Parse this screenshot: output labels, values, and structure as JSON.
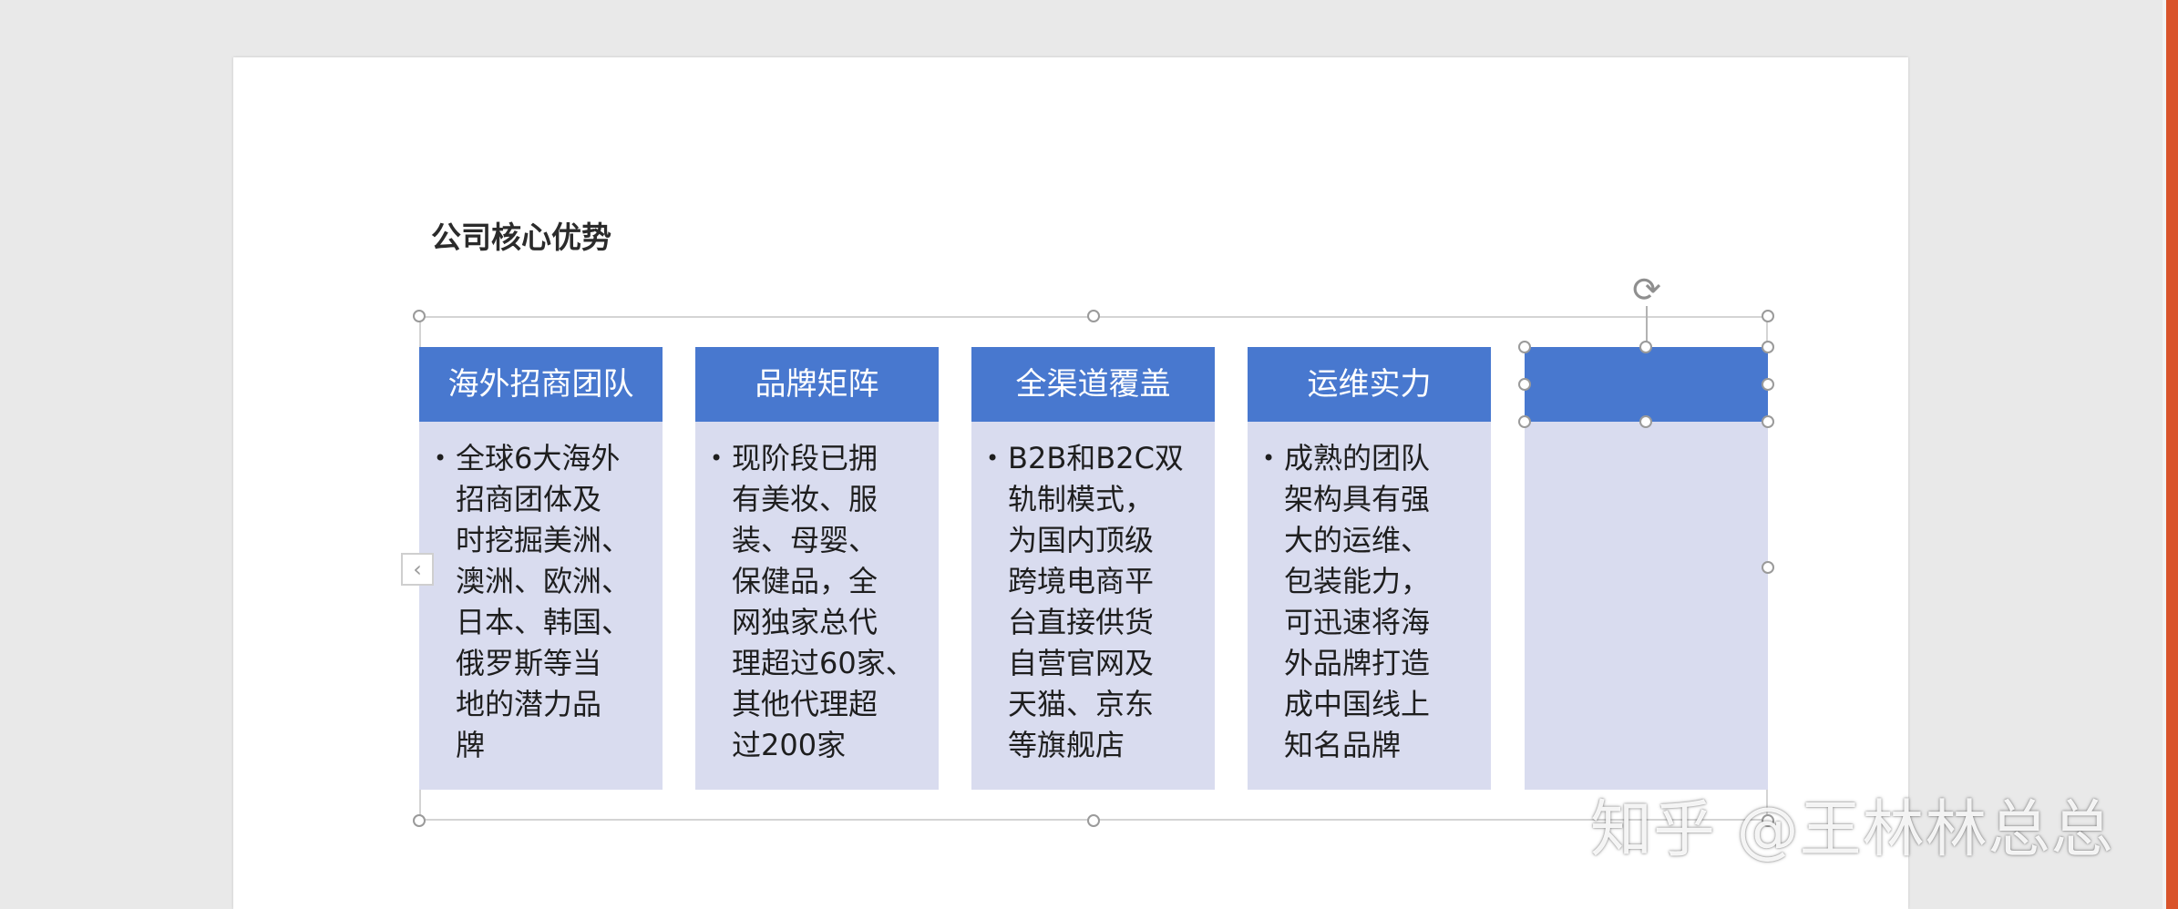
{
  "slide": {
    "title": "公司核心优势"
  },
  "cards": [
    {
      "header": "海外招商团队",
      "body": "全球6大海外\n招商团体及\n时挖掘美洲、\n澳洲、欧洲、\n日本、韩国、\n俄罗斯等当\n地的潜力品\n牌"
    },
    {
      "header": "品牌矩阵",
      "body": "现阶段已拥\n有美妆、服\n装、母婴、\n保健品，全\n网独家总代\n理超过60家、\n其他代理超\n过200家"
    },
    {
      "header": "全渠道覆盖",
      "body": "B2B和B2C双\n轨制模式，\n为国内顶级\n跨境电商平\n台直接供货\n自营官网及\n天猫、京东\n等旗舰店"
    },
    {
      "header": "运维实力",
      "body": "成熟的团队\n架构具有强\n大的运维、\n包装能力，\n可迅速将海\n外品牌打造\n成中国线上\n知名品牌"
    },
    {
      "header": "",
      "body": ""
    }
  ],
  "icons": {
    "rotate": "rotate-icon",
    "collapse": "chevron-left-icon",
    "bullet": "•"
  },
  "watermark": "知乎 @王林林总总",
  "colors": {
    "header_blue": "#4878cf",
    "card_fill": "#d9dcef",
    "accent_edge": "#d9532a"
  }
}
